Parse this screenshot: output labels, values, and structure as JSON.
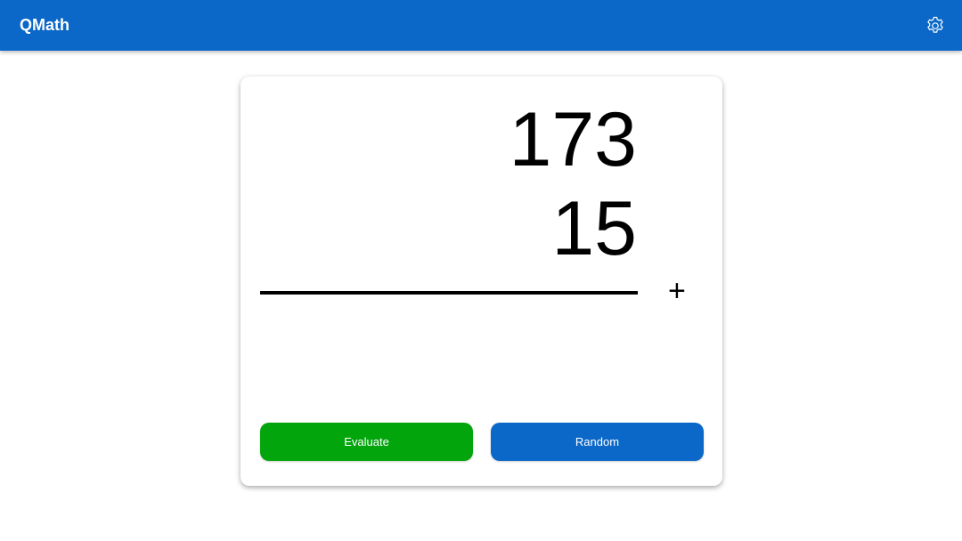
{
  "header": {
    "title": "QMath",
    "settings_icon": "gear-icon",
    "background_color": "#0b68c8"
  },
  "problem": {
    "operand_1": "173",
    "operand_2": "15",
    "operator": "+"
  },
  "actions": {
    "evaluate_label": "Evaluate",
    "evaluate_color": "#03a50d",
    "random_label": "Random",
    "random_color": "#0b68c8"
  }
}
